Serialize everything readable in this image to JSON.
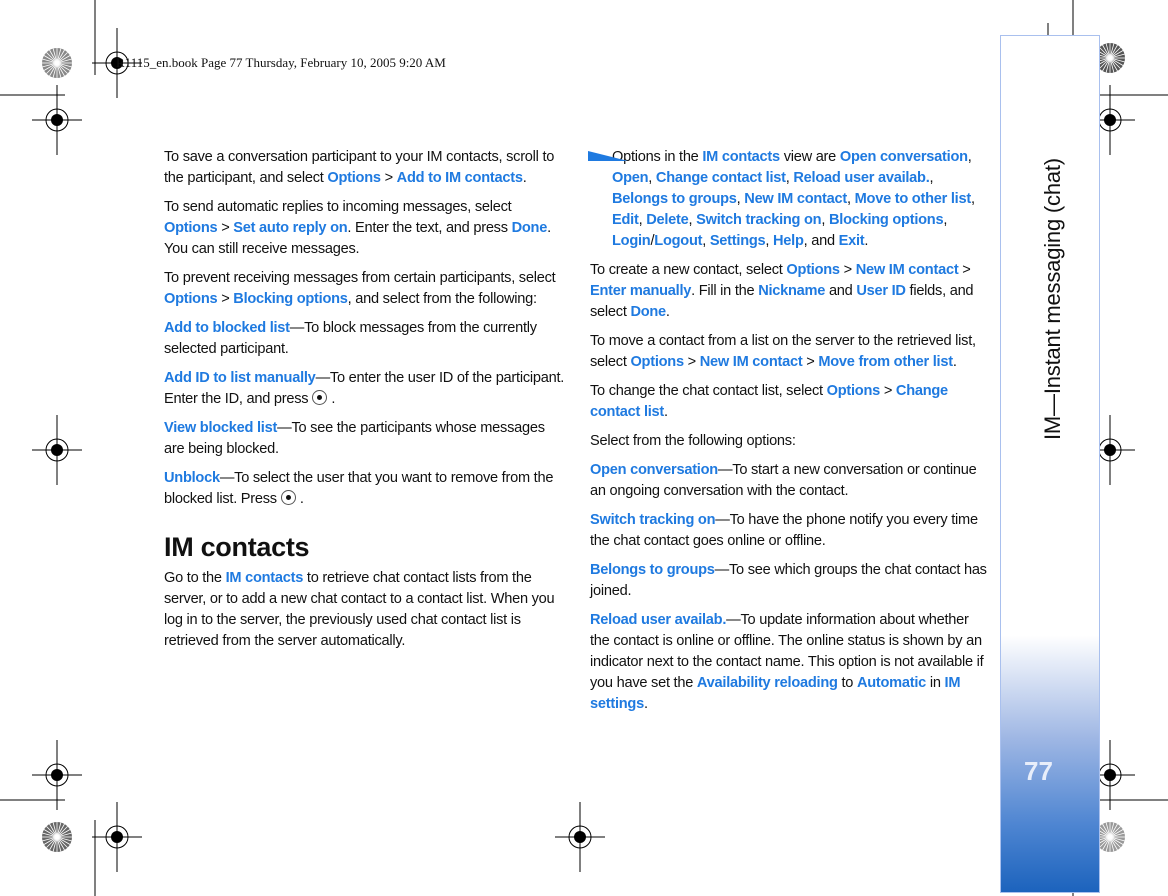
{
  "header": {
    "text": "R1115_en.book  Page 77  Thursday, February 10, 2005  9:20 AM"
  },
  "sidebar": {
    "chapter": "IM—Instant messaging (chat)",
    "page_number": "77"
  },
  "colors": {
    "link": "#1f7ae0",
    "sidebar_blue": "#1c63bd"
  },
  "left": [
    {
      "type": "p",
      "runs": [
        {
          "t": "To save a conversation participant to your IM contacts, scroll to the participant, and select "
        },
        {
          "t": "Options",
          "b": true
        },
        {
          "t": " > "
        },
        {
          "t": "Add to IM contacts",
          "b": true
        },
        {
          "t": "."
        }
      ]
    },
    {
      "type": "p",
      "runs": [
        {
          "t": "To send automatic replies to incoming messages, select "
        },
        {
          "t": "Options",
          "b": true
        },
        {
          "t": " > "
        },
        {
          "t": "Set auto reply on",
          "b": true
        },
        {
          "t": ". Enter the text, and press "
        },
        {
          "t": "Done",
          "b": true
        },
        {
          "t": ". You can still receive messages."
        }
      ]
    },
    {
      "type": "p",
      "runs": [
        {
          "t": "To prevent receiving messages from certain participants, select "
        },
        {
          "t": "Options",
          "b": true
        },
        {
          "t": " > "
        },
        {
          "t": "Blocking options",
          "b": true
        },
        {
          "t": ", and select from the following:"
        }
      ]
    },
    {
      "type": "p",
      "runs": [
        {
          "t": "Add to blocked list",
          "b": true
        },
        {
          "t": "—To block messages from the currently selected participant."
        }
      ]
    },
    {
      "type": "p",
      "runs": [
        {
          "t": "Add ID to list manually",
          "b": true
        },
        {
          "t": "—To enter the user ID of the participant. Enter the ID, and press"
        },
        {
          "icon": "joystick-select-icon"
        },
        {
          "t": "."
        }
      ]
    },
    {
      "type": "p",
      "runs": [
        {
          "t": "View blocked list",
          "b": true
        },
        {
          "t": "—To see the participants whose messages are being blocked."
        }
      ]
    },
    {
      "type": "p",
      "runs": [
        {
          "t": "Unblock",
          "b": true
        },
        {
          "t": "—To select the user that you want to remove from the blocked list. Press"
        },
        {
          "icon": "joystick-select-icon"
        },
        {
          "t": "."
        }
      ]
    },
    {
      "type": "h",
      "runs": [
        {
          "t": "IM contacts"
        }
      ]
    },
    {
      "type": "p",
      "runs": [
        {
          "t": "Go to the "
        },
        {
          "t": "IM contacts",
          "b": true
        },
        {
          "t": " to retrieve chat contact lists from the server, or to add a new chat contact to a contact list. When you log in to the server, the previously used chat contact list is retrieved from the server automatically."
        }
      ]
    }
  ],
  "right": [
    {
      "type": "note",
      "runs": [
        {
          "t": "Options in the "
        },
        {
          "t": "IM contacts",
          "b": true
        },
        {
          "t": " view are "
        },
        {
          "t": "Open conversation",
          "b": true
        },
        {
          "t": ", "
        },
        {
          "t": "Open",
          "b": true
        },
        {
          "t": ", "
        },
        {
          "t": "Change contact list",
          "b": true
        },
        {
          "t": ", "
        },
        {
          "t": "Reload user availab.",
          "b": true
        },
        {
          "t": ", "
        },
        {
          "t": "Belongs to groups",
          "b": true
        },
        {
          "t": ", "
        },
        {
          "t": "New IM contact",
          "b": true
        },
        {
          "t": ", "
        },
        {
          "t": "Move to other list",
          "b": true
        },
        {
          "t": ", "
        },
        {
          "t": "Edit",
          "b": true
        },
        {
          "t": ", "
        },
        {
          "t": "Delete",
          "b": true
        },
        {
          "t": ", "
        },
        {
          "t": "Switch tracking on",
          "b": true
        },
        {
          "t": ", "
        },
        {
          "t": "Blocking options",
          "b": true
        },
        {
          "t": ", "
        },
        {
          "t": "Login",
          "b": true
        },
        {
          "t": "/"
        },
        {
          "t": "Logout",
          "b": true
        },
        {
          "t": ", "
        },
        {
          "t": "Settings",
          "b": true
        },
        {
          "t": ", "
        },
        {
          "t": "Help",
          "b": true
        },
        {
          "t": ", and "
        },
        {
          "t": "Exit",
          "b": true
        },
        {
          "t": "."
        }
      ]
    },
    {
      "type": "p",
      "runs": [
        {
          "t": "To create a new contact, select "
        },
        {
          "t": "Options",
          "b": true
        },
        {
          "t": " > "
        },
        {
          "t": "New IM contact",
          "b": true
        },
        {
          "t": " > "
        },
        {
          "t": "Enter manually",
          "b": true
        },
        {
          "t": ". Fill in the "
        },
        {
          "t": "Nickname",
          "b": true
        },
        {
          "t": " and "
        },
        {
          "t": "User ID",
          "b": true
        },
        {
          "t": " fields, and select "
        },
        {
          "t": "Done",
          "b": true
        },
        {
          "t": "."
        }
      ]
    },
    {
      "type": "p",
      "runs": [
        {
          "t": "To move a contact from a list on the server to the retrieved list, select "
        },
        {
          "t": "Options",
          "b": true
        },
        {
          "t": " > "
        },
        {
          "t": "New IM contact",
          "b": true
        },
        {
          "t": " > "
        },
        {
          "t": "Move from other list",
          "b": true
        },
        {
          "t": "."
        }
      ]
    },
    {
      "type": "p",
      "runs": [
        {
          "t": "To change the chat contact list, select "
        },
        {
          "t": "Options",
          "b": true
        },
        {
          "t": " > "
        },
        {
          "t": "Change contact list",
          "b": true
        },
        {
          "t": "."
        }
      ]
    },
    {
      "type": "p",
      "runs": [
        {
          "t": "Select from the following options:"
        }
      ]
    },
    {
      "type": "p",
      "runs": [
        {
          "t": "Open conversation",
          "b": true
        },
        {
          "t": "—To start a new conversation or continue an ongoing conversation with the contact."
        }
      ]
    },
    {
      "type": "p",
      "runs": [
        {
          "t": "Switch tracking on",
          "b": true
        },
        {
          "t": "—To have the phone notify you every time the chat contact goes online or offline."
        }
      ]
    },
    {
      "type": "p",
      "runs": [
        {
          "t": "Belongs to groups",
          "b": true
        },
        {
          "t": "—To see which groups the chat contact has joined."
        }
      ]
    },
    {
      "type": "p",
      "runs": [
        {
          "t": "Reload user availab.",
          "b": true
        },
        {
          "t": "—To update information about whether the contact is online or offline. The online status is shown by an indicator next to the contact name. This option is not available if you have set the "
        },
        {
          "t": "Availability reloading",
          "b": true
        },
        {
          "t": " to "
        },
        {
          "t": "Automatic",
          "b": true
        },
        {
          "t": " in "
        },
        {
          "t": "IM settings",
          "b": true
        },
        {
          "t": "."
        }
      ]
    }
  ]
}
